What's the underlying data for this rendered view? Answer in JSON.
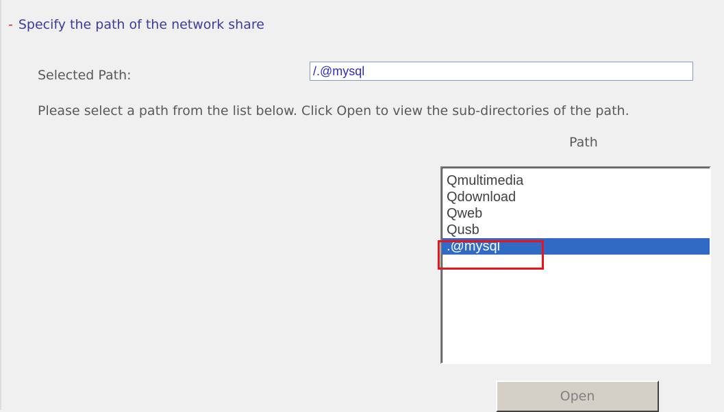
{
  "section": {
    "dash": "-",
    "title": "Specify the path of the network share"
  },
  "selected_path": {
    "label": "Selected Path:",
    "value": "/.@mysql"
  },
  "instructions": "Please select a path from the list below. Click Open to view the sub-directories of the path.",
  "path_list": {
    "header": "Path",
    "items": [
      {
        "label": "Qmultimedia",
        "selected": false
      },
      {
        "label": "Qdownload",
        "selected": false
      },
      {
        "label": "Qweb",
        "selected": false
      },
      {
        "label": "Qusb",
        "selected": false
      },
      {
        "label": ".@mysql",
        "selected": true
      }
    ],
    "highlighted_item": ".@mysql"
  },
  "buttons": {
    "open_label": "Open"
  },
  "colors": {
    "background": "#f0f0f0",
    "section_title": "#3b3b9c",
    "section_dash": "#e0201c",
    "selection": "#316ac5",
    "highlight_box": "#e8141c"
  }
}
